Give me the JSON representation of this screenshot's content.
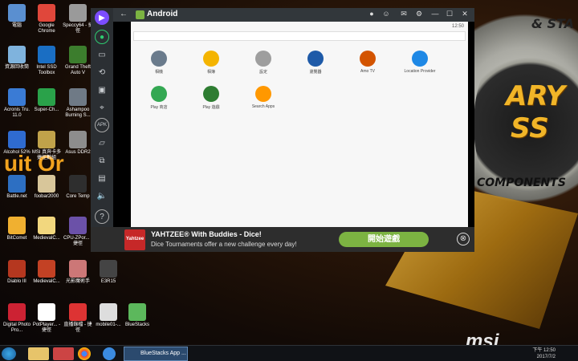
{
  "desktop": {
    "icons": [
      {
        "label": "電腦",
        "color": "#5a8fd0"
      },
      {
        "label": "Google Chrome",
        "color": "#e0473b"
      },
      {
        "label": "Speccy64 - 捷徑",
        "color": "#9a9a9a"
      },
      {
        "label": "資源回收筒",
        "color": "#7fb3dd"
      },
      {
        "label": "Intel SSD Toolbox",
        "color": "#1a6ec3"
      },
      {
        "label": "Grand Theft Auto V",
        "color": "#3c7d2d"
      },
      {
        "label": "Acronis Tru. 11.0",
        "color": "#3a7bd5"
      },
      {
        "label": "Super-Ch...",
        "color": "#2aa24a"
      },
      {
        "label": "Ashampoo Burning S...",
        "color": "#6f7a86"
      },
      {
        "label": "Alcohol 52%",
        "color": "#2f6bd0"
      },
      {
        "label": "MSI 真奔卡多 捷徑數組",
        "color": "#c0a24a"
      },
      {
        "label": "Asus DDR2",
        "color": "#8d8d8d"
      },
      {
        "label": "Battle.net",
        "color": "#2d6fc2"
      },
      {
        "label": "foobar2000",
        "color": "#d8c69a"
      },
      {
        "label": "Core Temp",
        "color": "#2e2e2e"
      },
      {
        "label": "BitComet",
        "color": "#f0b030"
      },
      {
        "label": "MedievalC...",
        "color": "#f2d77e"
      },
      {
        "label": "CPU-ZPor... - 捷徑",
        "color": "#6b51a8"
      },
      {
        "label": "Diablo III",
        "color": "#b5371f"
      },
      {
        "label": "MedievalC...",
        "color": "#c34124"
      },
      {
        "label": "光影魔術手",
        "color": "#c77"
      },
      {
        "label": "E3R15",
        "color": "#444"
      },
      {
        "label": "Digital Photo Pro...",
        "color": "#c23"
      },
      {
        "label": "PotPlayer... - 捷徑",
        "color": "#fff"
      },
      {
        "label": "直播錄檔 - 捷徑",
        "color": "#d33"
      },
      {
        "label": "mobile01-...",
        "color": "#ddd"
      },
      {
        "label": "BlueStacks",
        "color": "#5cb85c"
      }
    ],
    "wallpaper_texts": [
      "uit Or",
      "ARY",
      "SS",
      "COMPONENTS",
      "& STA"
    ]
  },
  "emulator": {
    "title": "Android",
    "status_time": "12:50",
    "side_icons": [
      "video-icon",
      "chat-icon",
      "layers-icon",
      "rotate-icon",
      "screenshot-icon",
      "location-icon",
      "apk-icon",
      "folder-icon",
      "copy-icon",
      "clipboard-icon",
      "volume-icon",
      "help-icon"
    ],
    "apps": [
      {
        "label": "相機",
        "color": "#6a7b8c"
      },
      {
        "label": "相簿",
        "color": "#f4b400"
      },
      {
        "label": "設定",
        "color": "#9e9e9e"
      },
      {
        "label": "瀏覽器",
        "color": "#1e5aa8"
      },
      {
        "label": "Amo TV",
        "color": "#d35400"
      },
      {
        "label": "Location Provider",
        "color": "#1e88e5"
      },
      {
        "label": "Play 商店",
        "color": "#34a853"
      },
      {
        "label": "Play 遊戲",
        "color": "#2e7d32"
      },
      {
        "label": "Search Apps",
        "color": "#ff9800"
      }
    ]
  },
  "ad": {
    "thumb_text": "Yahtzee",
    "title": "YAHTZEE® With Buddies - Dice!",
    "subtitle": "Dice Tournaments offer a new challenge every day!",
    "cta": "開始遊戲",
    "close": "⊗"
  },
  "taskbar": {
    "task_label": "BlueStacks App ...",
    "time": "下午 12:50",
    "date": "2017/7/2"
  },
  "brand": {
    "logo": "msi"
  }
}
